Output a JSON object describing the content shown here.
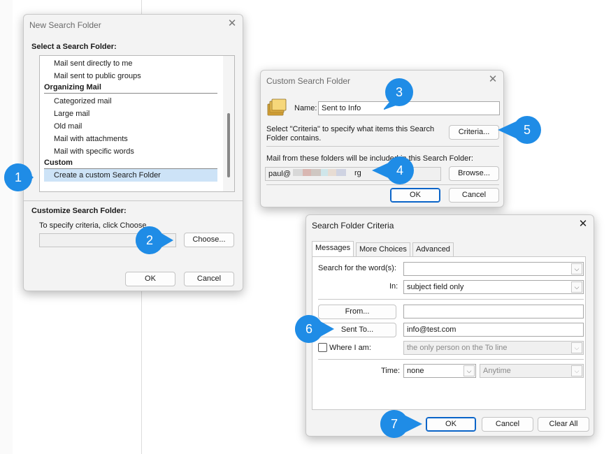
{
  "colors": {
    "accent": "#0a64c8",
    "badge": "#1f8ce6",
    "selection": "#cde3f7"
  },
  "new_search_folder": {
    "title": "New Search Folder",
    "select_label": "Select a Search Folder:",
    "items_top": [
      "Mail sent directly to me",
      "Mail sent to public groups"
    ],
    "group_organizing": "Organizing Mail",
    "items_organizing": [
      "Categorized mail",
      "Large mail",
      "Old mail",
      "Mail with attachments",
      "Mail with specific words"
    ],
    "group_custom": "Custom",
    "selected_item": "Create a custom Search Folder",
    "customize_label": "Customize Search Folder:",
    "criteria_hint": "To specify criteria, click Choose.",
    "choose_label": "Choose...",
    "ok_label": "OK",
    "cancel_label": "Cancel"
  },
  "custom_search_folder": {
    "title": "Custom Search Folder",
    "name_label": "Name:",
    "name_value": "Sent to Info",
    "criteria_text": "Select \"Criteria\" to specify what items this Search Folder contains.",
    "criteria_button": "Criteria...",
    "folders_text": "Mail from these folders will be included in this Search Folder:",
    "folder_value_prefix": "paul@",
    "folder_value_suffix": "rg",
    "browse_button": "Browse...",
    "ok_label": "OK",
    "cancel_label": "Cancel"
  },
  "criteria_dialog": {
    "title": "Search Folder Criteria",
    "tabs": [
      "Messages",
      "More Choices",
      "Advanced"
    ],
    "search_words_label": "Search for the word(s):",
    "search_words_value": "",
    "in_label": "In:",
    "in_value": "subject field only",
    "from_button": "From...",
    "from_value": "",
    "sent_to_button": "Sent To...",
    "sent_to_value": "info@test.com",
    "where_i_am_label": "Where I am:",
    "where_i_am_value": "the only person on the To line",
    "where_i_am_checked": false,
    "time_label": "Time:",
    "time_value": "none",
    "time_range_value": "Anytime",
    "ok_label": "OK",
    "cancel_label": "Cancel",
    "clear_all_label": "Clear All"
  },
  "callouts": [
    "1",
    "2",
    "3",
    "4",
    "5",
    "6",
    "7"
  ]
}
